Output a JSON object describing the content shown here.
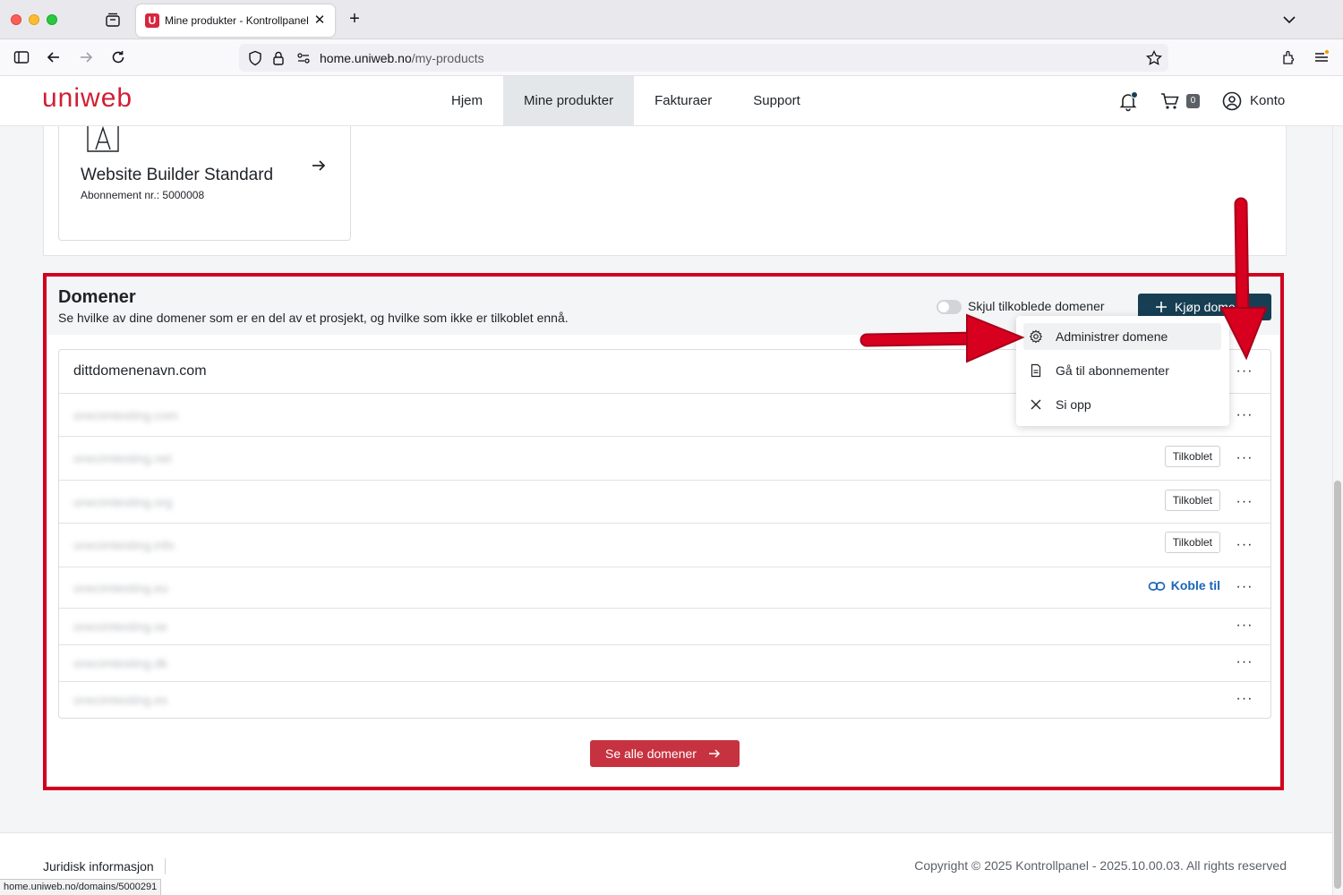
{
  "browser": {
    "tab_title": "Mine produkter - Kontrollpanel",
    "url_host": "home.uniweb.no",
    "url_path": "/my-products",
    "status_url": "home.uniweb.no/domains/5000291"
  },
  "header": {
    "logo": "uniweb",
    "nav": [
      "Hjem",
      "Mine produkter",
      "Fakturaer",
      "Support"
    ],
    "active_nav": "Mine produkter",
    "cart_count": "0",
    "account_label": "Konto"
  },
  "product": {
    "title": "Website Builder Standard",
    "subscription": "Abonnement nr.: 5000008"
  },
  "domains": {
    "title": "Domener",
    "subtitle": "Se hvilke av dine domener som er en del av et prosjekt, og hvilke som ikke er tilkoblet ennå.",
    "toggle_label": "Skjul tilkoblede domener",
    "toggle_on": false,
    "buy_button": "Kjøp domene",
    "rows": [
      {
        "name": "dittdomenenavn.com",
        "blurred": false,
        "status": ""
      },
      {
        "name": "onecimtesting.com",
        "blurred": true,
        "status": ""
      },
      {
        "name": "onecimtesting.net",
        "blurred": true,
        "status": "Tilkoblet"
      },
      {
        "name": "onecimtesting.org",
        "blurred": true,
        "status": "Tilkoblet"
      },
      {
        "name": "onecimtesting.info",
        "blurred": true,
        "status": "Tilkoblet"
      },
      {
        "name": "onecimtesting.eu",
        "blurred": true,
        "status": "",
        "action": "Koble til"
      },
      {
        "name": "onecimtesting.se",
        "blurred": true,
        "status": ""
      },
      {
        "name": "onecimtesting.dk",
        "blurred": true,
        "status": ""
      },
      {
        "name": "onecimtesting.es",
        "blurred": true,
        "status": ""
      }
    ],
    "see_all": "Se alle domener"
  },
  "context_menu": {
    "items": [
      {
        "label": "Administrer domene",
        "icon": "gear-icon"
      },
      {
        "label": "Gå til abonnementer",
        "icon": "document-icon"
      },
      {
        "label": "Si opp",
        "icon": "close-icon"
      }
    ]
  },
  "footer": {
    "legal": "Juridisk informasjon",
    "copyright": "Copyright © 2025 Kontrollpanel - 2025.10.00.03. All rights reserved"
  },
  "colors": {
    "brand": "#d11e34",
    "primary_button": "#163f54",
    "see_all_button": "#c73240",
    "highlight": "#d1001f",
    "link": "#1a66b8"
  }
}
